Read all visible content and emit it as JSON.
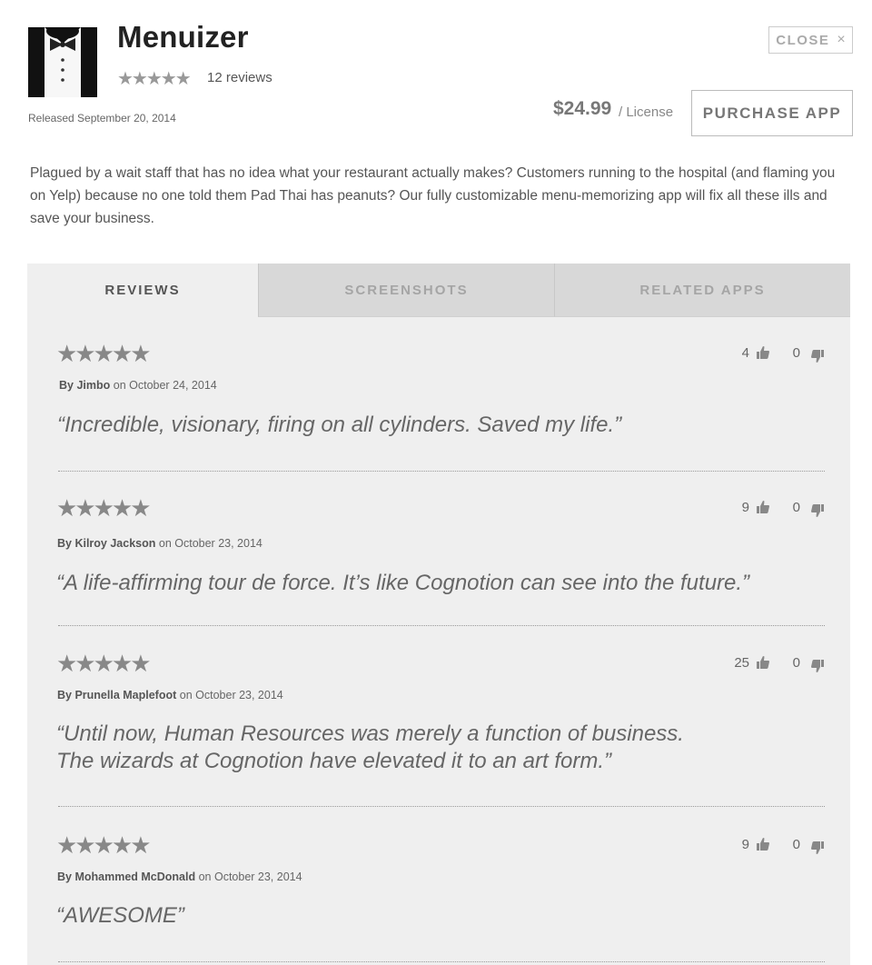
{
  "app": {
    "name": "Menuizer",
    "stars": "★★★★★",
    "reviews_count": "12 reviews",
    "released": "Released September 20, 2014",
    "price": "$24.99",
    "license": "/ License",
    "purchase_label": "PURCHASE APP",
    "close_label": "CLOSE",
    "close_icon": "×",
    "description": "Plagued by a wait staff that has no idea what your restaurant actually makes? Customers running to the hospital (and flaming you on Yelp) because no one told them Pad Thai has peanuts? Our fully customizable menu-memorizing app will fix all these ills and save your business."
  },
  "tabs": [
    {
      "label": "REVIEWS",
      "active": true
    },
    {
      "label": "SCREENSHOTS",
      "active": false
    },
    {
      "label": "RELATED APPS",
      "active": false
    }
  ],
  "reviews": [
    {
      "stars": "★★★★★",
      "by": "By Jimbo",
      "date": "on October 24, 2014",
      "quote": "“Incredible, visionary, firing on all cylinders. Saved my life.”",
      "up": "4",
      "down": "0"
    },
    {
      "stars": "★★★★★",
      "by": "By Kilroy Jackson",
      "date": "on October 23, 2014",
      "quote": "“A life-affirming tour de force. It’s like Cognotion can see into the future.”",
      "up": "9",
      "down": "0"
    },
    {
      "stars": "★★★★★",
      "by": "By Prunella Maplefoot",
      "date": "on October 23, 2014",
      "quote_line1": "“Until now, Human Resources was merely a function of business.",
      "quote_line2": "The wizards at Cognotion have elevated it to an art form.”",
      "up": "25",
      "down": "0"
    },
    {
      "stars": "★★★★★",
      "by": "By Mohammed McDonald",
      "date": "on October 23, 2014",
      "quote": "“AWESOME”",
      "up": "9",
      "down": "0"
    }
  ],
  "colors": {
    "panel_bg": "#efefef",
    "tab_inactive_bg": "#d8d8d8",
    "text_muted": "#888888"
  }
}
